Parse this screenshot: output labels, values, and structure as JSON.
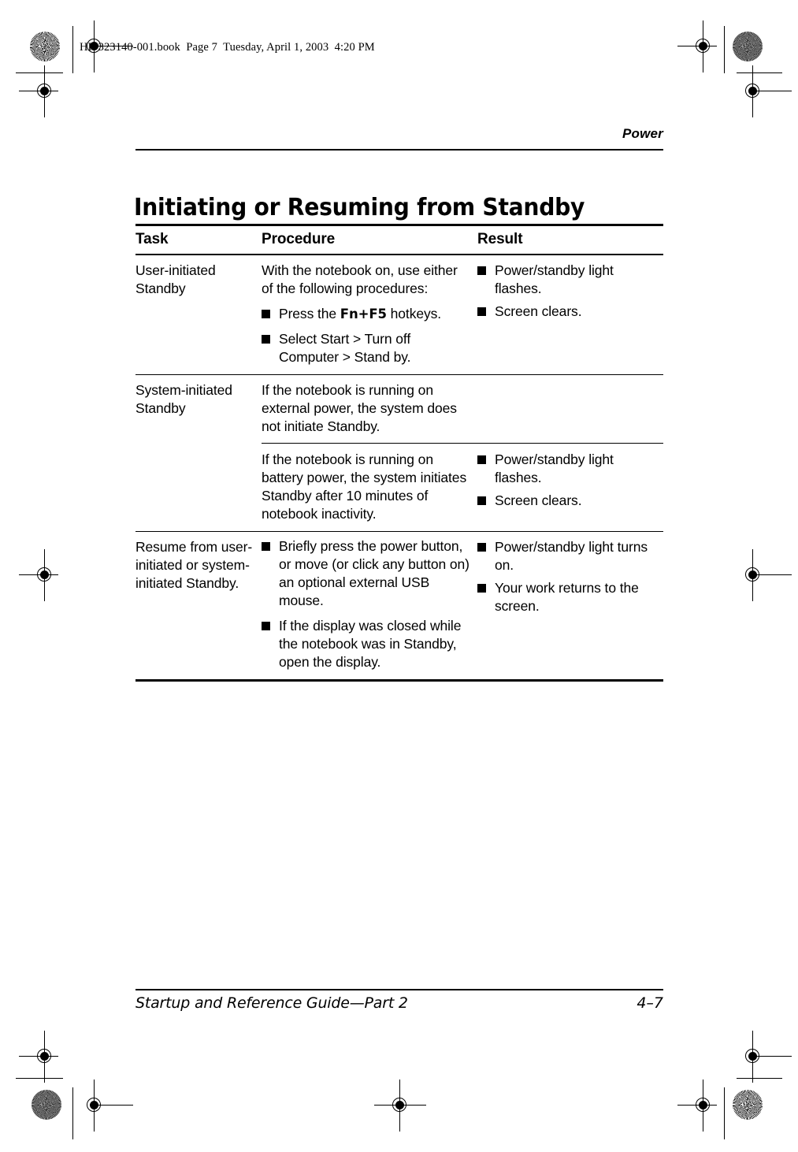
{
  "print_marks": {
    "registration_icon": "registration-target-icon",
    "starburst_icon": "starburst-density-icon"
  },
  "file_header": {
    "text": "HP-323140-001.book  Page 7  Tuesday, April 1, 2003  4:20 PM"
  },
  "running_head": {
    "text": "Power"
  },
  "page_title": "Initiating or Resuming from Standby",
  "table": {
    "headers": {
      "task": "Task",
      "procedure": "Procedure",
      "result": "Result"
    },
    "rows": [
      {
        "task": "User-initiated Standby",
        "procedure_intro": "With the notebook on, use either of the following procedures:",
        "procedure_bullets": [
          {
            "pre": "Press the ",
            "strong": "Fn+F5",
            "post": " hotkeys."
          },
          {
            "pre": "Select Start > Turn off Computer > Stand by.",
            "strong": "",
            "post": ""
          }
        ],
        "result_bullets": [
          "Power/standby light flashes.",
          "Screen clears."
        ]
      },
      {
        "task": "System-initiated Standby",
        "sub_rows": [
          {
            "procedure_intro": "If the notebook is running on external power, the system does not initiate Standby.",
            "result_bullets": []
          },
          {
            "procedure_intro": "If the notebook is running on battery power, the system initiates Standby after 10 minutes of notebook inactivity.",
            "result_bullets": [
              "Power/standby light flashes.",
              "Screen clears."
            ]
          }
        ]
      },
      {
        "task": "Resume from user-initiated or system-initiated Standby.",
        "procedure_intro": "",
        "procedure_bullets": [
          {
            "pre": "Briefly press the power button, or move (or click any button on) an optional external USB mouse.",
            "strong": "",
            "post": ""
          },
          {
            "pre": "If the display was closed while the notebook was in Standby, open the display.",
            "strong": "",
            "post": ""
          }
        ],
        "result_bullets": [
          "Power/standby light turns on.",
          "Your work returns to the screen."
        ]
      }
    ]
  },
  "footer": {
    "guide_title": "Startup and Reference Guide—Part 2",
    "page_number": "4–7"
  }
}
